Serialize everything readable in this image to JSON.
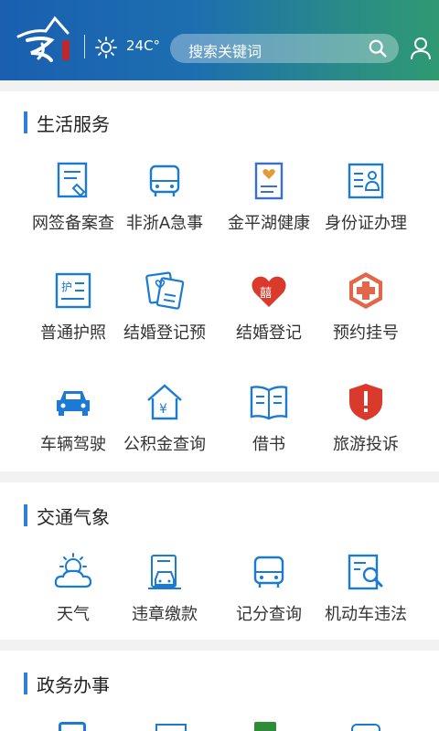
{
  "header": {
    "temperature": "24C°",
    "search_placeholder": "搜索关键词"
  },
  "sections": [
    {
      "title": "生活服务",
      "items": [
        {
          "label": "网签备案查",
          "icon": "contract-icon"
        },
        {
          "label": "非浙A急事",
          "icon": "bus-icon"
        },
        {
          "label": "金平湖健康",
          "icon": "health-card-icon"
        },
        {
          "label": "身份证办理",
          "icon": "id-card-icon"
        },
        {
          "label": "普通护照",
          "icon": "passport-icon"
        },
        {
          "label": "结婚登记预",
          "icon": "marriage-cards-icon"
        },
        {
          "label": "结婚登记",
          "icon": "double-happiness-icon"
        },
        {
          "label": "预约挂号",
          "icon": "hospital-cross-icon"
        },
        {
          "label": "车辆驾驶",
          "icon": "car-icon"
        },
        {
          "label": "公积金查询",
          "icon": "housing-fund-icon"
        },
        {
          "label": "借书",
          "icon": "book-icon"
        },
        {
          "label": "旅游投诉",
          "icon": "alert-shield-icon"
        }
      ]
    },
    {
      "title": "交通气象",
      "items": [
        {
          "label": "天气",
          "icon": "weather-icon"
        },
        {
          "label": "违章缴款",
          "icon": "violation-payment-icon"
        },
        {
          "label": "记分查询",
          "icon": "bus-icon"
        },
        {
          "label": "机动车违法",
          "icon": "search-document-icon"
        }
      ]
    },
    {
      "title": "政务办事",
      "items": []
    }
  ],
  "colors": {
    "accent": "#2f7fd8",
    "icon_blue": "#1a7ad4",
    "icon_red": "#d93a2b"
  }
}
